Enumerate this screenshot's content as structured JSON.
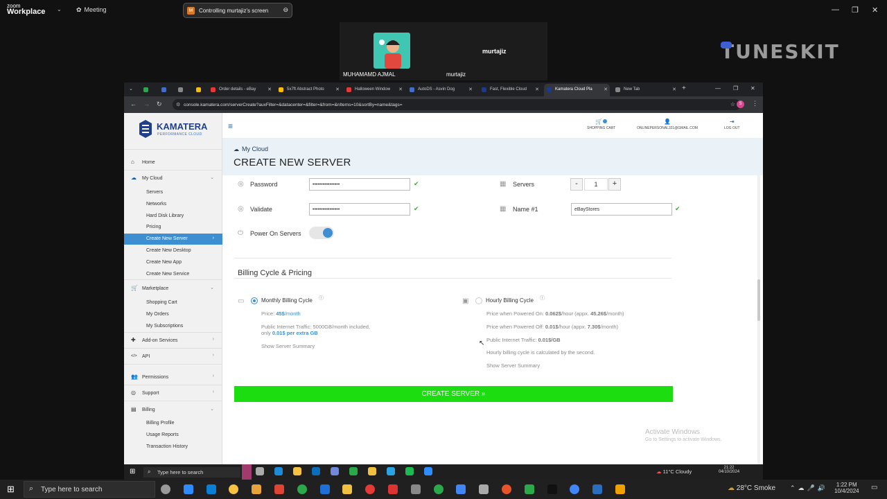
{
  "zoom": {
    "logo_small": "zoom",
    "logo_big": "Workplace",
    "meeting_label": "Meeting",
    "control_banner": "Controlling murtajiz's screen",
    "control_initial": "M",
    "participants": [
      {
        "name": "MUHAMAMD AJMAL"
      },
      {
        "name": "murtajiz",
        "display": "murtajiz"
      }
    ]
  },
  "watermark": "TUNESKIT",
  "browser": {
    "tabs": [
      {
        "label": "",
        "color": "#2aa84a"
      },
      {
        "label": "",
        "color": "#3d6fd1"
      },
      {
        "label": "",
        "color": "#888"
      },
      {
        "label": "",
        "color": "#fbbc04"
      },
      {
        "label": "Order details - eBay",
        "color": "#e53935"
      },
      {
        "label": "5x7ft Abstract Photo",
        "color": "#fbbc04"
      },
      {
        "label": "Halloween Window",
        "color": "#e53935"
      },
      {
        "label": "AutoDS - Asvin Dog",
        "color": "#3d6fd1"
      },
      {
        "label": "Fast, Flexible Cloud",
        "color": "#1a3a8a"
      },
      {
        "label": "Kamatera Cloud Pla",
        "color": "#1a3a8a"
      },
      {
        "label": "New Tab",
        "color": "#888"
      }
    ],
    "url": "console.kamatera.com/serverCreate?auxFilter=&datacenter=&filter=&from=&nItems=10&sortBy=name&tags="
  },
  "brand": {
    "name": "KAMATERA",
    "tagline": "PERFORMANCE CLOUD"
  },
  "sidebar": {
    "home": "Home",
    "my_cloud": "My Cloud",
    "cloud_items": [
      "Servers",
      "Networks",
      "Hard Disk Library",
      "Pricing",
      "Create New Server",
      "Create New Desktop",
      "Create New App",
      "Create New Service"
    ],
    "marketplace": "Marketplace",
    "market_items": [
      "Shopping Cart",
      "My Orders",
      "My Subscriptions"
    ],
    "addon": "Add-on Services",
    "api": "API",
    "permissions": "Permissions",
    "support": "Support",
    "billing": "Billing",
    "billing_items": [
      "Billing Profile",
      "Usage Reports",
      "Transaction History"
    ]
  },
  "header": {
    "cart": "SHOPPING CART",
    "email": "ONLINEPERSONAL321@GMAIL.COM",
    "logout": "LOG OUT"
  },
  "title": {
    "breadcrumb": "My Cloud",
    "page_title": "CREATE NEW SERVER"
  },
  "form": {
    "password_label": "Password",
    "password_value": "••••••••••••••••",
    "validate_label": "Validate",
    "validate_value": "••••••••••••••••",
    "power_label": "Power On Servers",
    "power_on": true,
    "servers_label": "Servers",
    "servers_count": "1",
    "name_label": "Name #1",
    "name_value": "eBayStores"
  },
  "billing": {
    "heading": "Billing Cycle & Pricing",
    "monthly": {
      "label": "Monthly Billing Cycle",
      "price_prefix": "Price: ",
      "price": "45$",
      "price_suffix": "/month",
      "traffic1": "Public Internet Traffic: 5000GB/month included,",
      "traffic2_prefix": "only ",
      "traffic2_value": "0.01$ per extra GB",
      "summary": "Show Server Summary"
    },
    "hourly": {
      "label": "Hourly Billing Cycle",
      "on_prefix": "Price when Powered On: ",
      "on_price": "0.062$",
      "on_mid": "/hour (appx. ",
      "on_month": "45.26$",
      "on_suffix": "/month)",
      "off_prefix": "Price when Powered Off: ",
      "off_price": "0.01$",
      "off_mid": "/hour (appx. ",
      "off_month": "7.30$",
      "off_suffix": "/month)",
      "traffic_prefix": "Public Internet Traffic: ",
      "traffic_value": "0.01$/GB",
      "note": "Hourly billing cycle is calculated by the second.",
      "summary": "Show Server Summary"
    },
    "create_button": "CREATE SERVER »"
  },
  "activate": {
    "title": "Activate Windows",
    "sub": "Go to Settings to activate Windows."
  },
  "inner_taskbar": {
    "search": "Type here to search",
    "weather": "11°C  Cloudy",
    "time": "21:22",
    "date": "04/10/2024"
  },
  "taskbar": {
    "search": "Type here to search",
    "weather": "28°C  Smoke",
    "time": "1:22 PM",
    "date": "10/4/2024"
  },
  "colors": {
    "accent": "#3d8fd1",
    "create": "#1bdd10",
    "check": "#3aaa35"
  }
}
